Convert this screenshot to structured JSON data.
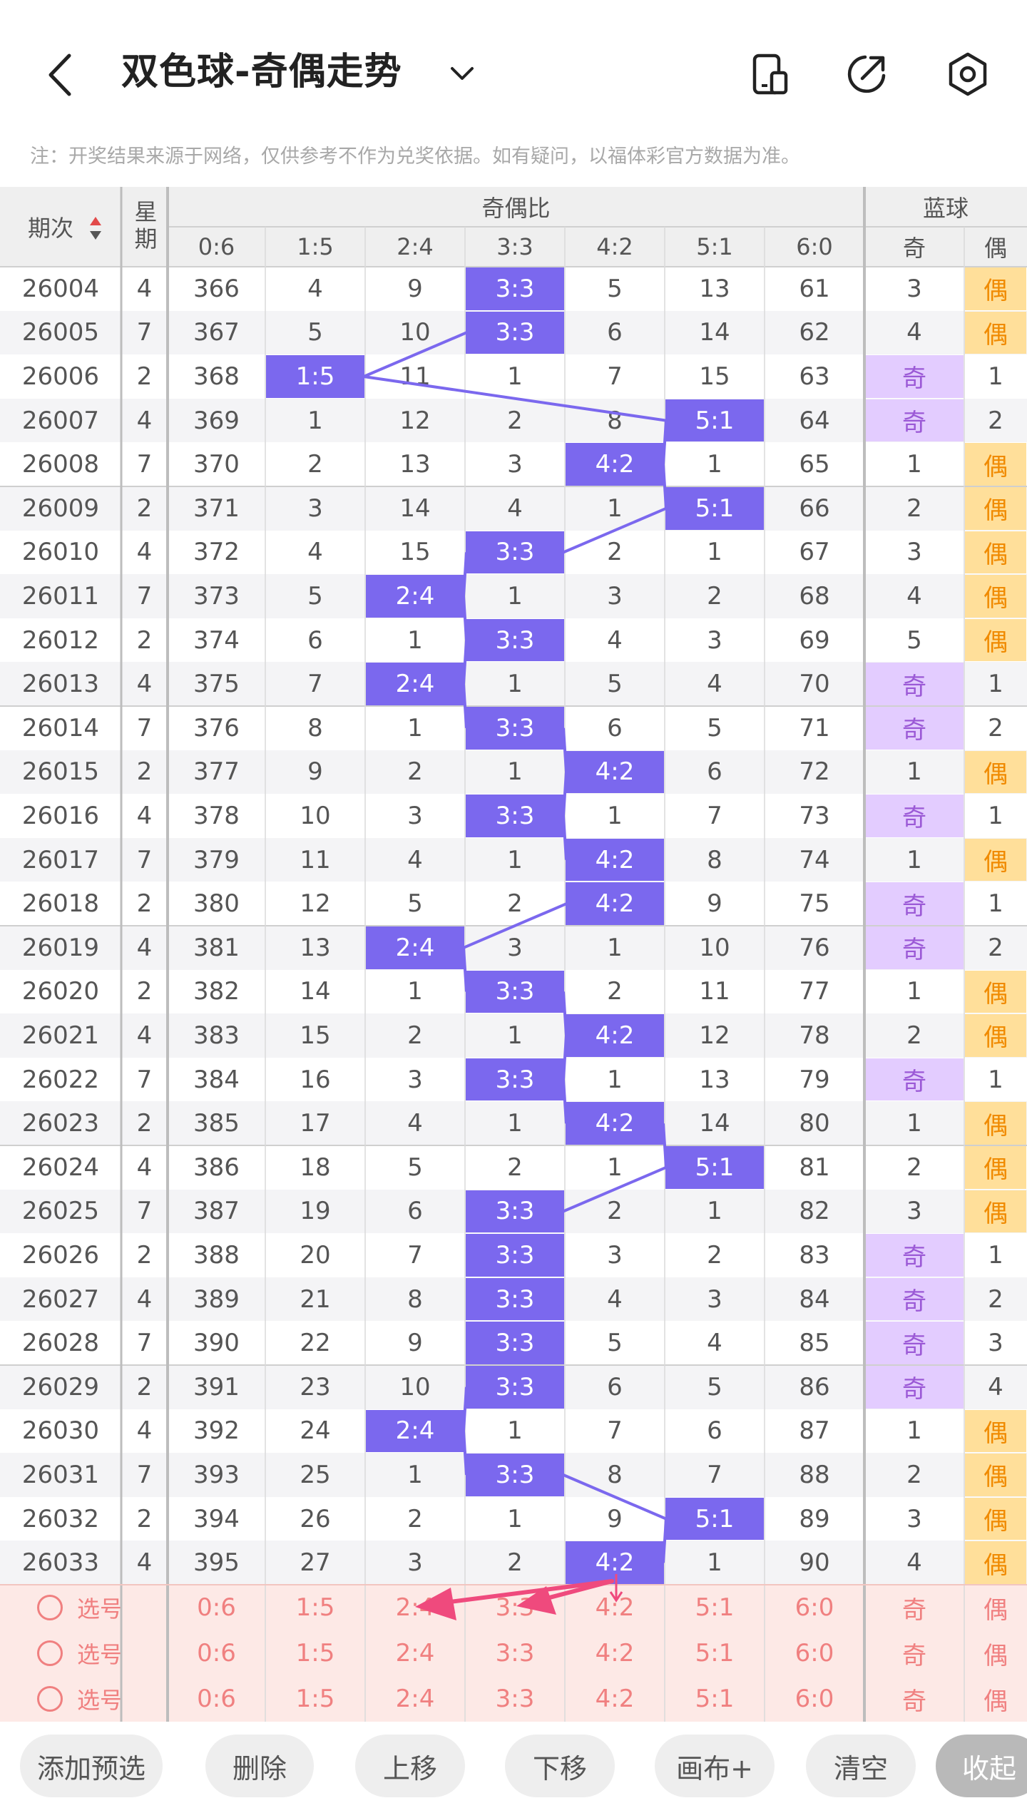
{
  "header": {
    "title": "双色球-奇偶走势",
    "note": "注：开奖结果来源于网络，仅供参考不作为兑奖依据。如有疑问，以福体彩官方数据为准。"
  },
  "table": {
    "headers": {
      "period": "期次",
      "week": "星期",
      "group": "奇偶比",
      "blue": "蓝球",
      "ratios": [
        "0:6",
        "1:5",
        "2:4",
        "3:3",
        "4:2",
        "5:1",
        "6:0"
      ],
      "blue_cols": [
        "奇",
        "偶"
      ]
    },
    "rows": [
      {
        "period": "26004",
        "week": "4",
        "hit": 3,
        "cells": [
          "366",
          "4",
          "9",
          "3:3",
          "5",
          "13",
          "61"
        ],
        "blue": "odd",
        "blue_cells": [
          "3",
          "偶"
        ]
      },
      {
        "period": "26005",
        "week": "7",
        "hit": 3,
        "cells": [
          "367",
          "5",
          "10",
          "3:3",
          "6",
          "14",
          "62"
        ],
        "blue": "odd",
        "blue_cells": [
          "4",
          "偶"
        ]
      },
      {
        "period": "26006",
        "week": "2",
        "hit": 1,
        "cells": [
          "368",
          "1:5",
          "11",
          "1",
          "7",
          "15",
          "63"
        ],
        "blue": "even",
        "blue_cells": [
          "奇",
          "1"
        ]
      },
      {
        "period": "26007",
        "week": "4",
        "hit": 5,
        "cells": [
          "369",
          "1",
          "12",
          "2",
          "8",
          "5:1",
          "64"
        ],
        "blue": "even",
        "blue_cells": [
          "奇",
          "2"
        ]
      },
      {
        "period": "26008",
        "week": "7",
        "hit": 4,
        "cells": [
          "370",
          "2",
          "13",
          "3",
          "4:2",
          "1",
          "65"
        ],
        "blue": "odd",
        "blue_cells": [
          "1",
          "偶"
        ]
      },
      {
        "period": "26009",
        "week": "2",
        "hit": 5,
        "cells": [
          "371",
          "3",
          "14",
          "4",
          "1",
          "5:1",
          "66"
        ],
        "blue": "odd",
        "blue_cells": [
          "2",
          "偶"
        ]
      },
      {
        "period": "26010",
        "week": "4",
        "hit": 3,
        "cells": [
          "372",
          "4",
          "15",
          "3:3",
          "2",
          "1",
          "67"
        ],
        "blue": "odd",
        "blue_cells": [
          "3",
          "偶"
        ]
      },
      {
        "period": "26011",
        "week": "7",
        "hit": 2,
        "cells": [
          "373",
          "5",
          "2:4",
          "1",
          "3",
          "2",
          "68"
        ],
        "blue": "odd",
        "blue_cells": [
          "4",
          "偶"
        ]
      },
      {
        "period": "26012",
        "week": "2",
        "hit": 3,
        "cells": [
          "374",
          "6",
          "1",
          "3:3",
          "4",
          "3",
          "69"
        ],
        "blue": "odd",
        "blue_cells": [
          "5",
          "偶"
        ]
      },
      {
        "period": "26013",
        "week": "4",
        "hit": 2,
        "cells": [
          "375",
          "7",
          "2:4",
          "1",
          "5",
          "4",
          "70"
        ],
        "blue": "even",
        "blue_cells": [
          "奇",
          "1"
        ]
      },
      {
        "period": "26014",
        "week": "7",
        "hit": 3,
        "cells": [
          "376",
          "8",
          "1",
          "3:3",
          "6",
          "5",
          "71"
        ],
        "blue": "even",
        "blue_cells": [
          "奇",
          "2"
        ]
      },
      {
        "period": "26015",
        "week": "2",
        "hit": 4,
        "cells": [
          "377",
          "9",
          "2",
          "1",
          "4:2",
          "6",
          "72"
        ],
        "blue": "odd",
        "blue_cells": [
          "1",
          "偶"
        ]
      },
      {
        "period": "26016",
        "week": "4",
        "hit": 3,
        "cells": [
          "378",
          "10",
          "3",
          "3:3",
          "1",
          "7",
          "73"
        ],
        "blue": "even",
        "blue_cells": [
          "奇",
          "1"
        ]
      },
      {
        "period": "26017",
        "week": "7",
        "hit": 4,
        "cells": [
          "379",
          "11",
          "4",
          "1",
          "4:2",
          "8",
          "74"
        ],
        "blue": "odd",
        "blue_cells": [
          "1",
          "偶"
        ]
      },
      {
        "period": "26018",
        "week": "2",
        "hit": 4,
        "cells": [
          "380",
          "12",
          "5",
          "2",
          "4:2",
          "9",
          "75"
        ],
        "blue": "even",
        "blue_cells": [
          "奇",
          "1"
        ]
      },
      {
        "period": "26019",
        "week": "4",
        "hit": 2,
        "cells": [
          "381",
          "13",
          "2:4",
          "3",
          "1",
          "10",
          "76"
        ],
        "blue": "even",
        "blue_cells": [
          "奇",
          "2"
        ]
      },
      {
        "period": "26020",
        "week": "2",
        "hit": 3,
        "cells": [
          "382",
          "14",
          "1",
          "3:3",
          "2",
          "11",
          "77"
        ],
        "blue": "odd",
        "blue_cells": [
          "1",
          "偶"
        ]
      },
      {
        "period": "26021",
        "week": "4",
        "hit": 4,
        "cells": [
          "383",
          "15",
          "2",
          "1",
          "4:2",
          "12",
          "78"
        ],
        "blue": "odd",
        "blue_cells": [
          "2",
          "偶"
        ]
      },
      {
        "period": "26022",
        "week": "7",
        "hit": 3,
        "cells": [
          "384",
          "16",
          "3",
          "3:3",
          "1",
          "13",
          "79"
        ],
        "blue": "even",
        "blue_cells": [
          "奇",
          "1"
        ]
      },
      {
        "period": "26023",
        "week": "2",
        "hit": 4,
        "cells": [
          "385",
          "17",
          "4",
          "1",
          "4:2",
          "14",
          "80"
        ],
        "blue": "odd",
        "blue_cells": [
          "1",
          "偶"
        ]
      },
      {
        "period": "26024",
        "week": "4",
        "hit": 5,
        "cells": [
          "386",
          "18",
          "5",
          "2",
          "1",
          "5:1",
          "81"
        ],
        "blue": "odd",
        "blue_cells": [
          "2",
          "偶"
        ]
      },
      {
        "period": "26025",
        "week": "7",
        "hit": 3,
        "cells": [
          "387",
          "19",
          "6",
          "3:3",
          "2",
          "1",
          "82"
        ],
        "blue": "odd",
        "blue_cells": [
          "3",
          "偶"
        ]
      },
      {
        "period": "26026",
        "week": "2",
        "hit": 3,
        "cells": [
          "388",
          "20",
          "7",
          "3:3",
          "3",
          "2",
          "83"
        ],
        "blue": "even",
        "blue_cells": [
          "奇",
          "1"
        ]
      },
      {
        "period": "26027",
        "week": "4",
        "hit": 3,
        "cells": [
          "389",
          "21",
          "8",
          "3:3",
          "4",
          "3",
          "84"
        ],
        "blue": "even",
        "blue_cells": [
          "奇",
          "2"
        ]
      },
      {
        "period": "26028",
        "week": "7",
        "hit": 3,
        "cells": [
          "390",
          "22",
          "9",
          "3:3",
          "5",
          "4",
          "85"
        ],
        "blue": "even",
        "blue_cells": [
          "奇",
          "3"
        ]
      },
      {
        "period": "26029",
        "week": "2",
        "hit": 3,
        "cells": [
          "391",
          "23",
          "10",
          "3:3",
          "6",
          "5",
          "86"
        ],
        "blue": "even",
        "blue_cells": [
          "奇",
          "4"
        ]
      },
      {
        "period": "26030",
        "week": "4",
        "hit": 2,
        "cells": [
          "392",
          "24",
          "2:4",
          "1",
          "7",
          "6",
          "87"
        ],
        "blue": "odd",
        "blue_cells": [
          "1",
          "偶"
        ]
      },
      {
        "period": "26031",
        "week": "7",
        "hit": 3,
        "cells": [
          "393",
          "25",
          "1",
          "3:3",
          "8",
          "7",
          "88"
        ],
        "blue": "odd",
        "blue_cells": [
          "2",
          "偶"
        ]
      },
      {
        "period": "26032",
        "week": "2",
        "hit": 5,
        "cells": [
          "394",
          "26",
          "2",
          "1",
          "9",
          "5:1",
          "89"
        ],
        "blue": "odd",
        "blue_cells": [
          "3",
          "偶"
        ]
      },
      {
        "period": "26033",
        "week": "4",
        "hit": 4,
        "cells": [
          "395",
          "27",
          "3",
          "2",
          "4:2",
          "1",
          "90"
        ],
        "blue": "odd",
        "blue_cells": [
          "4",
          "偶"
        ]
      }
    ],
    "pick_rows": [
      {
        "label": "选号",
        "cells": [
          "0:6",
          "1:5",
          "2:4",
          "3:3",
          "4:2",
          "5:1",
          "6:0"
        ],
        "blue_cells": [
          "奇",
          "偶"
        ]
      },
      {
        "label": "选号",
        "cells": [
          "0:6",
          "1:5",
          "2:4",
          "3:3",
          "4:2",
          "5:1",
          "6:0"
        ],
        "blue_cells": [
          "奇",
          "偶"
        ]
      },
      {
        "label": "选号",
        "cells": [
          "0:6",
          "1:5",
          "2:4",
          "3:3",
          "4:2",
          "5:1",
          "6:0"
        ],
        "blue_cells": [
          "奇",
          "偶"
        ]
      }
    ]
  },
  "buttons": [
    "添加预选",
    "删除",
    "上移",
    "下移",
    "画布+",
    "清空",
    "收起"
  ],
  "colors": {
    "highlight": "#7b68ee",
    "odd_bg": "#e3ccff",
    "even_bg": "#ffdf9a",
    "pick_bg": "#fde9e6",
    "arrow": "#ef4a7d"
  },
  "icons": [
    "back-icon",
    "chevron-down-icon",
    "phone-icon",
    "share-icon",
    "settings-icon",
    "sort-icon",
    "circle-select-icon"
  ]
}
